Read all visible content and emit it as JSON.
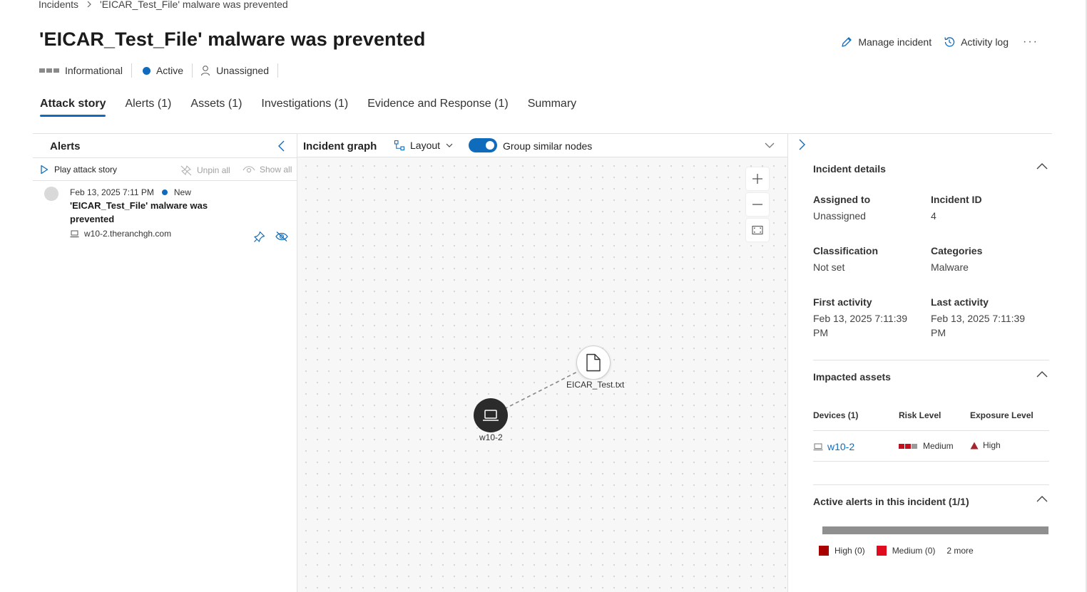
{
  "breadcrumb": {
    "root": "Incidents",
    "current": "'EICAR_Test_File' malware was prevented"
  },
  "title": "'EICAR_Test_File' malware was prevented",
  "top_actions": {
    "manage": "Manage incident",
    "activity": "Activity log",
    "more": "···"
  },
  "status": {
    "severity": "Informational",
    "state": "Active",
    "assignee": "Unassigned"
  },
  "tabs": [
    {
      "label": "Attack story",
      "active": true
    },
    {
      "label": "Alerts (1)"
    },
    {
      "label": "Assets (1)"
    },
    {
      "label": "Investigations (1)"
    },
    {
      "label": "Evidence and Response (1)"
    },
    {
      "label": "Summary"
    }
  ],
  "alerts_panel": {
    "title": "Alerts",
    "play": "Play attack story",
    "unpin_all": "Unpin all",
    "show_all": "Show all",
    "alert": {
      "date": "Feb 13, 2025 7:11 PM",
      "status": "New",
      "title": "'EICAR_Test_File' malware was prevented",
      "device": "w10-2.theranchgh.com"
    }
  },
  "graph": {
    "title": "Incident graph",
    "layout": "Layout",
    "group_similar": "Group similar nodes",
    "group_similar_on": true,
    "nodes": {
      "file": "EICAR_Test.txt",
      "device": "w10-2"
    }
  },
  "details": {
    "section_title": "Incident details",
    "assigned_to_label": "Assigned to",
    "assigned_to": "Unassigned",
    "incident_id_label": "Incident ID",
    "incident_id": "4",
    "classification_label": "Classification",
    "classification": "Not set",
    "categories_label": "Categories",
    "categories": "Malware",
    "first_activity_label": "First activity",
    "first_activity": "Feb 13, 2025 7:11:39 PM",
    "last_activity_label": "Last activity",
    "last_activity": "Feb 13, 2025 7:11:39 PM"
  },
  "impacted": {
    "section_title": "Impacted assets",
    "col_devices": "Devices (1)",
    "col_risk": "Risk Level",
    "col_exposure": "Exposure Level",
    "device": "w10-2",
    "risk": "Medium",
    "exposure": "High"
  },
  "active_alerts": {
    "section_title": "Active alerts in this incident (1/1)",
    "legend": [
      {
        "label": "High (0)",
        "color": "#a80000"
      },
      {
        "label": "Medium (0)",
        "color": "#e00b1c"
      }
    ],
    "more": "2 more"
  },
  "colors": {
    "accent": "#0f6cbd",
    "risk_medium": "#c50f1f",
    "exposure_high": "#a4262c"
  }
}
